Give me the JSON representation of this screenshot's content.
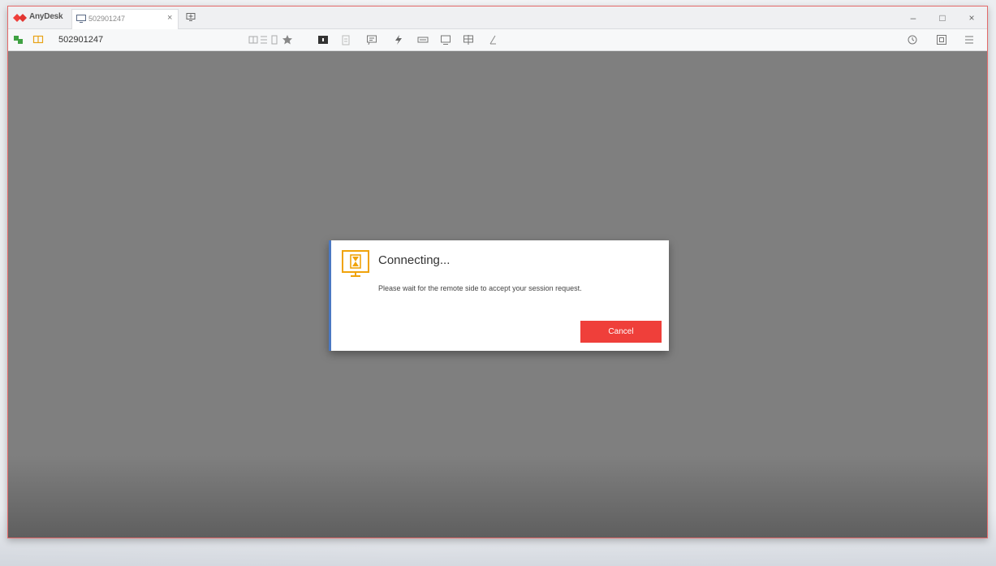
{
  "app": {
    "brand": "AnyDesk",
    "accent_color": "#ef3f3a"
  },
  "tab": {
    "label": "502901247",
    "close_glyph": "×"
  },
  "window_controls": {
    "minimize": "–",
    "maximize": "□",
    "close": "×"
  },
  "toolbar": {
    "address": "502901247",
    "icons": [
      "connection-status-icon",
      "permissions-icon",
      "disconnect-icon",
      "align-icon",
      "file-icon",
      "bookmark-star-icon",
      "monitor-select-icon",
      "clipboard-icon",
      "chat-icon",
      "actions-icon",
      "keyboard-icon",
      "display-icon",
      "windows-icon",
      "draw-icon",
      "history-icon",
      "screenshot-icon",
      "menu-icon"
    ]
  },
  "dialog": {
    "title": "Connecting...",
    "message": "Please wait for the remote side to accept your session request.",
    "cancel_label": "Cancel"
  }
}
